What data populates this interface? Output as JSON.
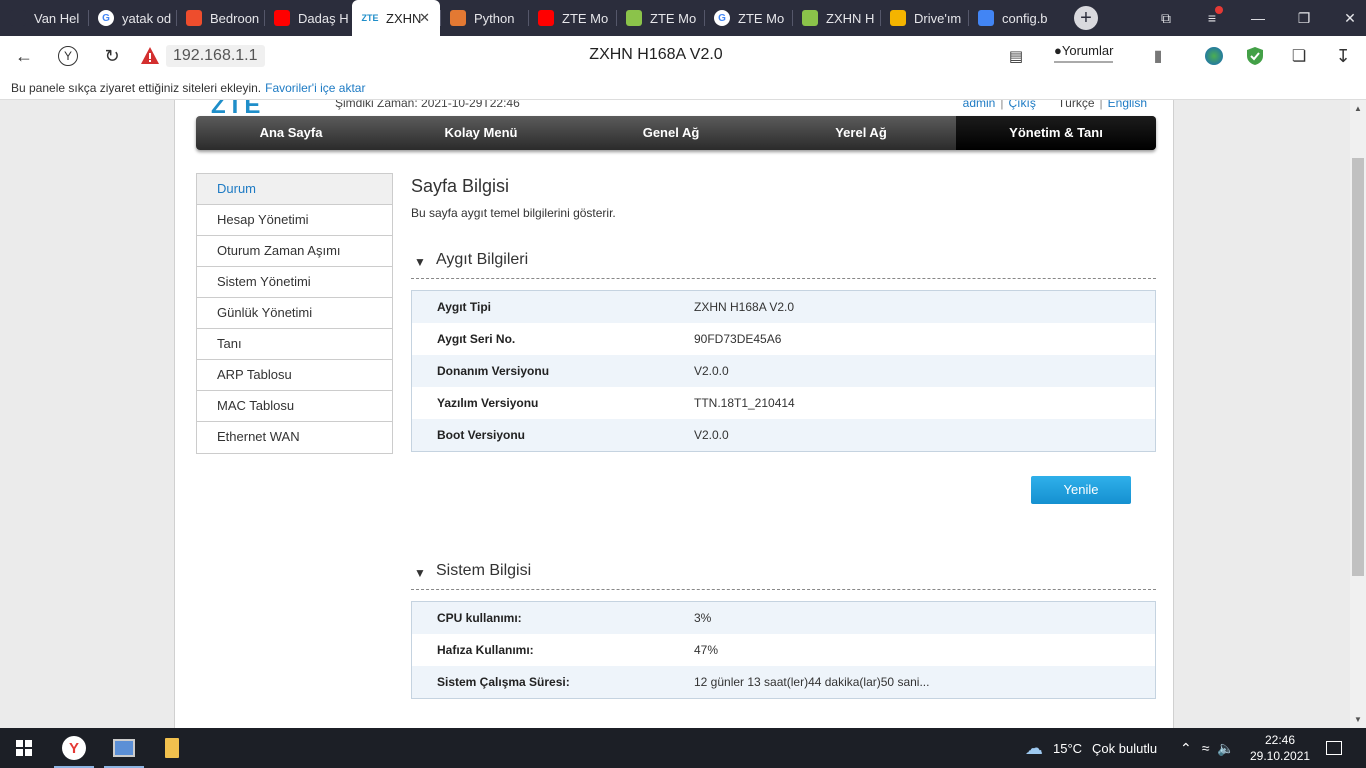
{
  "browser": {
    "tabs": [
      {
        "label": "Van Hel",
        "icon": "pen-icon",
        "color": "#2b2d3c"
      },
      {
        "label": "yatak od",
        "icon": "google-icon",
        "color": "#ffffff"
      },
      {
        "label": "Bedroon",
        "icon": "brand-icon",
        "color": "#ee4d2d"
      },
      {
        "label": "Dadaş H",
        "icon": "youtube-icon",
        "color": "#ff0000"
      },
      {
        "label": "ZXHN",
        "icon": "zte-icon",
        "color": "#1f8ec9",
        "icon_text": "ZTE",
        "active": true
      },
      {
        "label": "Python",
        "icon": "python-icon",
        "color": "#e37933"
      },
      {
        "label": "ZTE Mo",
        "icon": "youtube-icon",
        "color": "#ff0000"
      },
      {
        "label": "ZTE Mo",
        "icon": "power-icon",
        "color": "#8bc34a"
      },
      {
        "label": "ZTE Mo",
        "icon": "google-icon",
        "color": "#ffffff"
      },
      {
        "label": "ZXHN H",
        "icon": "power-icon",
        "color": "#8bc34a"
      },
      {
        "label": "Drive'ım",
        "icon": "drive-icon",
        "color": "#f4b400"
      },
      {
        "label": "config.b",
        "icon": "drive-icon",
        "color": "#4285f4"
      }
    ],
    "address": "192.168.1.1",
    "page_title": "ZXHN H168A V2.0",
    "comments_label": "Yorumlar",
    "favbar_text": "Bu panele sıkça ziyaret ettiğiniz siteleri ekleyin.",
    "favbar_link": "Favoriler'i içe aktar"
  },
  "router": {
    "logo": "ZTE",
    "current_time": "Şimdiki Zaman: 2021-10-29T22:46",
    "user": "admin",
    "logout": "Çıkış",
    "lang_tr": "Türkçe",
    "lang_en": "English",
    "nav": [
      "Ana Sayfa",
      "Kolay Menü",
      "Genel Ağ",
      "Yerel Ağ",
      "Yönetim & Tanı"
    ],
    "side_menu": [
      "Durum",
      "Hesap Yönetimi",
      "Oturum Zaman Aşımı",
      "Sistem Yönetimi",
      "Günlük Yönetimi",
      "Tanı",
      "ARP Tablosu",
      "MAC Tablosu",
      "Ethernet WAN"
    ],
    "page_heading": "Sayfa Bilgisi",
    "page_desc": "Bu sayfa aygıt temel bilgilerini gösterir.",
    "device_section": "Aygıt Bilgileri",
    "device_rows": [
      {
        "k": "Aygıt Tipi",
        "v": "ZXHN H168A V2.0"
      },
      {
        "k": "Aygıt Seri No.",
        "v": "90FD73DE45A6"
      },
      {
        "k": "Donanım Versiyonu",
        "v": "V2.0.0"
      },
      {
        "k": "Yazılım Versiyonu",
        "v": "TTN.18T1_210414"
      },
      {
        "k": "Boot Versiyonu",
        "v": "V2.0.0"
      }
    ],
    "refresh_label": "Yenile",
    "system_section": "Sistem Bilgisi",
    "system_rows": [
      {
        "k": "CPU kullanımı:",
        "v": "3%"
      },
      {
        "k": "Hafıza Kullanımı:",
        "v": "47%"
      },
      {
        "k": "Sistem Çalışma Süresi:",
        "v": "12 günler 13 saat(ler)44 dakika(lar)50 sani..."
      }
    ]
  },
  "taskbar": {
    "weather_temp": "15°C",
    "weather_text": "Çok bulutlu",
    "time": "22:46",
    "date": "29.10.2021"
  }
}
